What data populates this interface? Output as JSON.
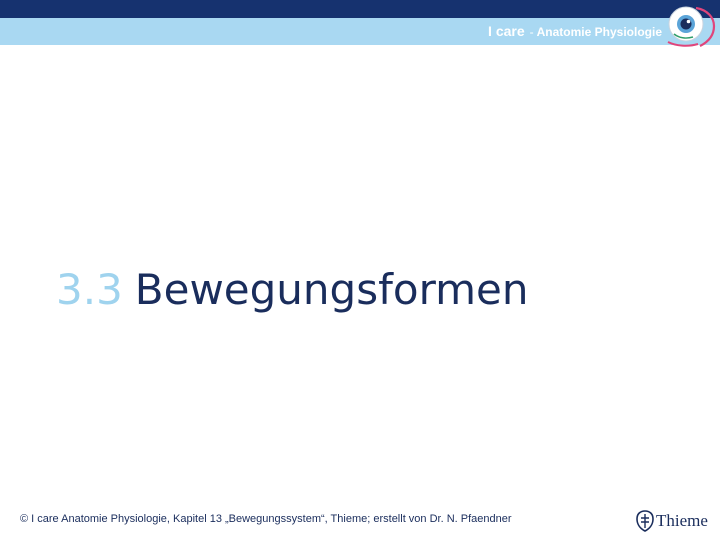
{
  "header": {
    "brand_main": "I care",
    "brand_separator": "-",
    "brand_sub": "Anatomie Physiologie",
    "logo_icon": "eye-icon"
  },
  "main": {
    "section_number": "3.3",
    "section_title": "Bewegungsformen"
  },
  "footer": {
    "copyright": "© I care Anatomie Physiologie, Kapitel 13 „Bewegungssystem“, Thieme; erstellt von Dr. N. Pfaendner",
    "publisher": "Thieme",
    "publisher_icon": "thieme-seal-icon"
  },
  "colors": {
    "top_bar": "#16326f",
    "sub_bar": "#a9d8f2",
    "section_number": "#9fd3ee",
    "title_text": "#1a2d5c"
  }
}
